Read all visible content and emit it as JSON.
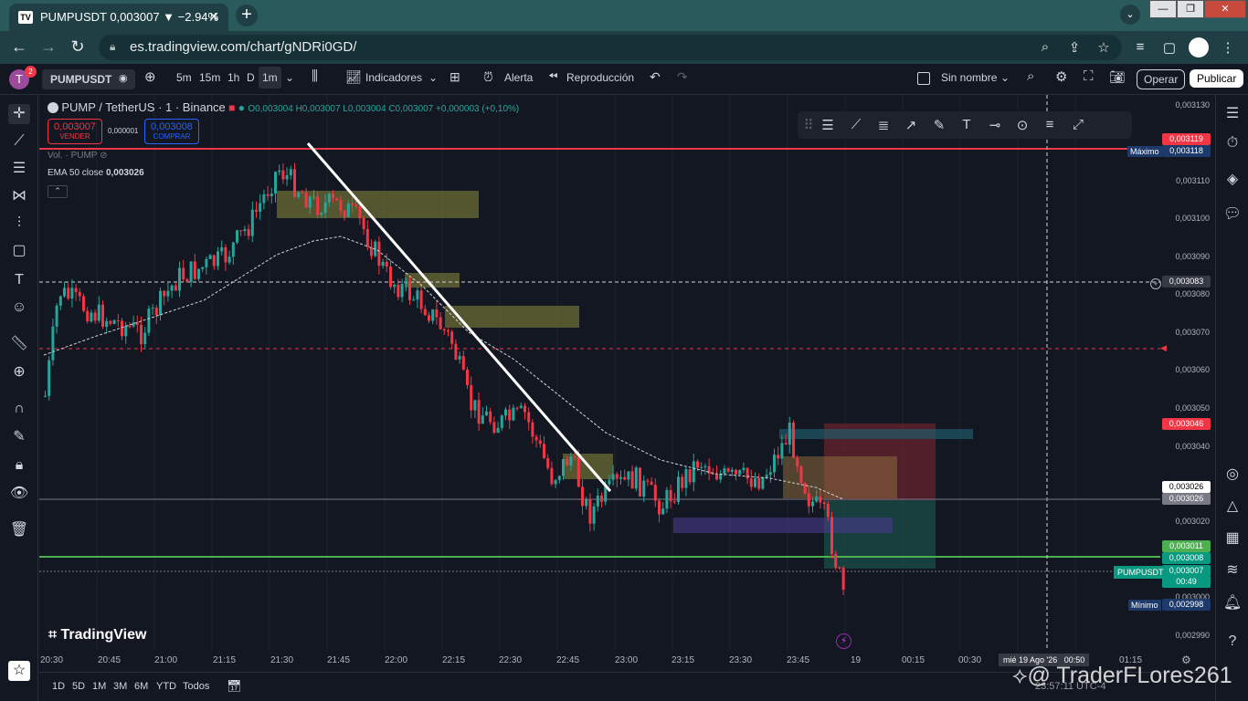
{
  "browser": {
    "tab_title": "PUMPUSDT 0,003007 ▼ −2.94%",
    "url": "es.tradingview.com/chart/gNDRi0GD/"
  },
  "toolbar": {
    "symbol": "PUMPUSDT",
    "intervals": [
      "5m",
      "15m",
      "1h",
      "D",
      "1m"
    ],
    "indicators": "Indicadores",
    "alert": "Alerta",
    "replay": "Reproducción",
    "layout_name": "Sin nombre",
    "trade": "Operar",
    "publish": "Publicar",
    "notif_count": "2",
    "avatar": "T"
  },
  "legend": {
    "title": "PUMP / TetherUS · 1 · Binance",
    "ohlc": "O0,003004 H0,003007 L0,003004 C0,003007 +0,000003 (+0,10%)",
    "sell_price": "0,003007",
    "sell_label": "VENDER",
    "spread": "0,000001",
    "buy_price": "0,003008",
    "buy_label": "COMPRAR",
    "vol": "Vol. · PUMP",
    "ema_label": "EMA 50 close",
    "ema_value": "0,003026"
  },
  "price_axis": {
    "ticks": [
      "0,003130",
      "0,003110",
      "0,003100",
      "0,003090",
      "0,003080",
      "0,003070",
      "0,003060",
      "0,003050",
      "0,003040",
      "0,003020",
      "0,003000",
      "0,002990"
    ],
    "max_label": "Máximo",
    "max_value": "0,003118",
    "red_line_value": "0,003119",
    "crosshair_value": "0,003083",
    "red_box": "0,003046",
    "white_box": "0,003026",
    "gray_box": "0,003026",
    "green_box": "0,003011",
    "price_box": "0,003008",
    "symbol_tag": "PUMPUSDT",
    "last_price": "0,003007",
    "countdown": "00:49",
    "min_label": "Mínimo",
    "min_value": "0,002998"
  },
  "time_axis": {
    "ticks": [
      "20:30",
      "20:45",
      "21:00",
      "21:15",
      "21:30",
      "21:45",
      "22:00",
      "22:15",
      "22:30",
      "22:45",
      "23:00",
      "23:15",
      "23:30",
      "23:45",
      "19",
      "00:15",
      "00:30",
      "01:15"
    ],
    "cursor_label": "mié 19 Ago '26",
    "cursor_time": "00:50"
  },
  "bottom": {
    "ranges": [
      "1D",
      "5D",
      "1M",
      "3M",
      "6M",
      "YTD",
      "Todos"
    ],
    "clock": "23:57:11 UTC-4"
  },
  "watermark": {
    "logo": "TradingView",
    "credit": "@ TraderFLores261"
  },
  "colors": {
    "up": "#26a69a",
    "down": "#f23645",
    "bg": "#131722"
  }
}
